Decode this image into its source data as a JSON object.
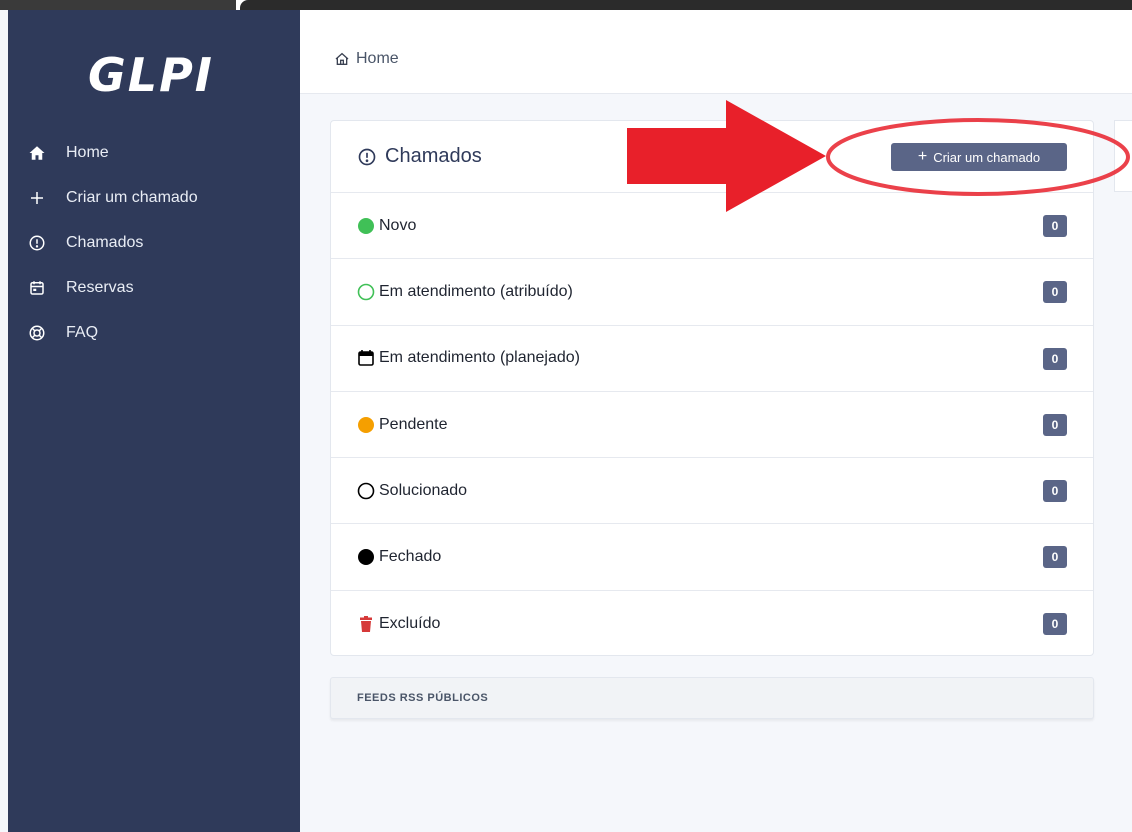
{
  "app": {
    "logo_text": "GLPI"
  },
  "sidebar": {
    "items": [
      {
        "label": "Home",
        "icon": "home-icon"
      },
      {
        "label": "Criar um chamado",
        "icon": "plus-icon"
      },
      {
        "label": "Chamados",
        "icon": "alert-circle-icon"
      },
      {
        "label": "Reservas",
        "icon": "calendar-icon"
      },
      {
        "label": "FAQ",
        "icon": "lifebuoy-icon"
      }
    ]
  },
  "header": {
    "breadcrumb": "Home",
    "breadcrumb_icon": "home-outline-icon"
  },
  "tickets_card": {
    "title": "Chamados",
    "create_button": "Criar um chamado",
    "rows": [
      {
        "label": "Novo",
        "count": "0",
        "icon": "green-filled-circle-icon",
        "color": "#40c057"
      },
      {
        "label": "Em atendimento (atribuído)",
        "count": "0",
        "icon": "green-outline-circle-icon",
        "color": "#40c057"
      },
      {
        "label": "Em atendimento (planejado)",
        "count": "0",
        "icon": "calendar-icon",
        "color": "#000000"
      },
      {
        "label": "Pendente",
        "count": "0",
        "icon": "orange-filled-circle-icon",
        "color": "#f59f00"
      },
      {
        "label": "Solucionado",
        "count": "0",
        "icon": "black-outline-circle-icon",
        "color": "#000000"
      },
      {
        "label": "Fechado",
        "count": "0",
        "icon": "black-filled-circle-icon",
        "color": "#000000"
      },
      {
        "label": "Excluído",
        "count": "0",
        "icon": "trash-icon",
        "color": "#d63939"
      }
    ]
  },
  "feeds": {
    "title": "FEEDS RSS PÚBLICOS"
  },
  "colors": {
    "sidebar_bg": "#2f3a5a",
    "button_bg": "#5a6587",
    "annotation_red": "#e8202a"
  }
}
